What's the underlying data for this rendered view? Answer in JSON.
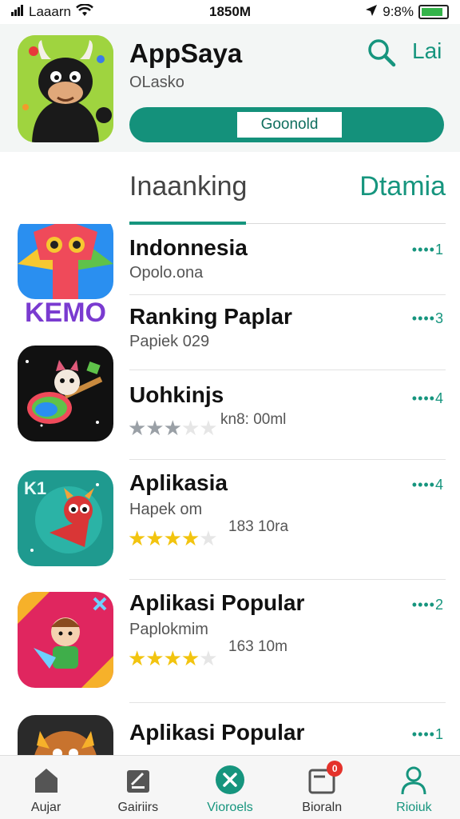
{
  "status_bar": {
    "carrier": "Laaarn",
    "time": "1850M",
    "battery_text": "9:8%"
  },
  "header": {
    "app_name": "AppSaya",
    "subtitle": "OLasko",
    "link_label": "Lai",
    "progress_label": "Goonold"
  },
  "tabs": [
    {
      "label": "Inaanking",
      "active": true
    },
    {
      "label": "Dtamia",
      "active": false
    }
  ],
  "list": [
    {
      "title": "Indonnesia",
      "subtitle": "Opolo.ona",
      "rank": "••••1",
      "icon": "kemo-app-icon",
      "icon_text": "KEMO"
    },
    {
      "title": "Ranking Paplar",
      "subtitle": "Papiek 029",
      "rank": "••••3",
      "icon": "none"
    },
    {
      "title": "Uohkinjs",
      "subtitle": "",
      "rank": "••••4",
      "icon": "guitar-app-icon",
      "rating": 3,
      "rating_color": "gray",
      "meta": "kn8: 00ml"
    },
    {
      "title": "Aplikasia",
      "subtitle": "Hapek om",
      "rank": "••••4",
      "icon": "rocket-app-icon",
      "icon_text": "K1",
      "rating": 4.5,
      "rating_color": "gold",
      "meta": "183 10ra"
    },
    {
      "title": "Aplikasi Popular",
      "subtitle": "Paplokmim",
      "rank": "••••2",
      "icon": "kid-app-icon",
      "rating": 4.5,
      "rating_color": "gold",
      "meta": "163 10m"
    },
    {
      "title": "Aplikasi Popular",
      "subtitle": "",
      "rank": "••••1",
      "icon": "warrior-app-icon"
    }
  ],
  "bottom_nav": [
    {
      "label": "Aujar",
      "icon": "home-icon",
      "active": false
    },
    {
      "label": "Gairiirs",
      "icon": "games-icon",
      "active": false
    },
    {
      "label": "Vioroels",
      "icon": "close-circle-icon",
      "active": true
    },
    {
      "label": "Bioraln",
      "icon": "inbox-icon",
      "active": false,
      "badge": "0"
    },
    {
      "label": "Rioiuk",
      "icon": "profile-icon",
      "active": true
    }
  ],
  "colors": {
    "accent": "#16957e",
    "star_gold": "#f2c40f",
    "badge_red": "#e4322b"
  }
}
